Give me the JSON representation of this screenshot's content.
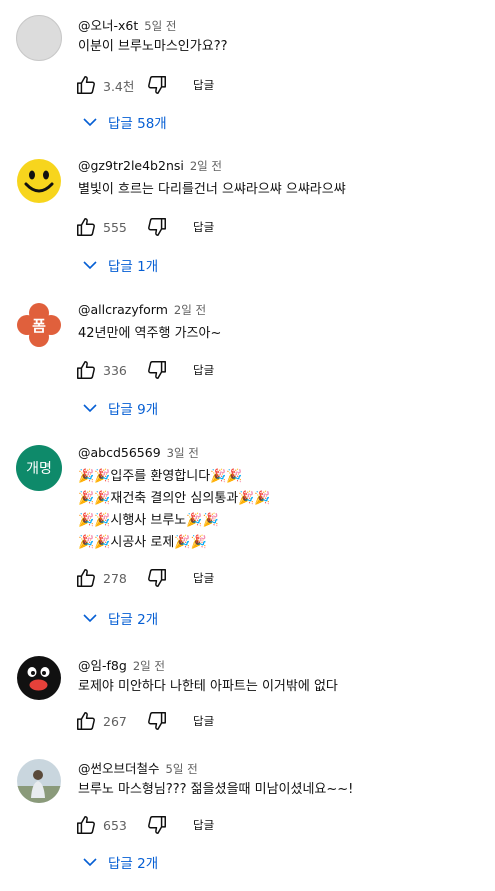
{
  "comments": [
    {
      "handle": "@오너-x6t",
      "time": "5일 전",
      "lines": [
        "이분이 브루노마스인가요??"
      ],
      "likes": "3.4천",
      "reply_label": "답글",
      "replies": "답글 58개",
      "avatar": "gray"
    },
    {
      "handle": "@gz9tr2le4b2nsi",
      "time": "2일 전",
      "lines": [
        "별빛이 흐르는 다리를건너 으쌰라으쌰 으쌰라으쌰"
      ],
      "likes": "555",
      "reply_label": "답글",
      "replies": "답글 1개",
      "avatar": "smiley"
    },
    {
      "handle": "@allcrazyform",
      "time": "2일 전",
      "lines": [
        "42년만에 역주행 가즈아~"
      ],
      "likes": "336",
      "reply_label": "답글",
      "replies": "답글 9개",
      "avatar": "flower",
      "avatar_text": "폼"
    },
    {
      "handle": "@abcd56569",
      "time": "3일 전",
      "lines": [
        "🎉🎉입주를 환영합니다🎉🎉",
        "🎉🎉재건축 결의안 심의통과🎉🎉",
        "🎉🎉시행사 브루노🎉🎉",
        "🎉🎉시공사 로제🎉🎉"
      ],
      "likes": "278",
      "reply_label": "답글",
      "replies": "답글 2개",
      "avatar": "teal",
      "avatar_text": "개명"
    },
    {
      "handle": "@임-f8g",
      "time": "2일 전",
      "lines": [
        "로제야 미안하다 나한테 아파트는 이거밖에 없다"
      ],
      "likes": "267",
      "reply_label": "답글",
      "replies": "",
      "avatar": "penguin"
    },
    {
      "handle": "@썬오브더철수",
      "time": "5일 전",
      "lines": [
        "브루노 마스형님??? 젊을셨을때 미남이셨네요~~!"
      ],
      "likes": "653",
      "reply_label": "답글",
      "replies": "답글 2개",
      "avatar": "photo"
    }
  ],
  "colors": {
    "link": "#065fd4",
    "meta": "#606060",
    "text": "#0f0f0f"
  }
}
